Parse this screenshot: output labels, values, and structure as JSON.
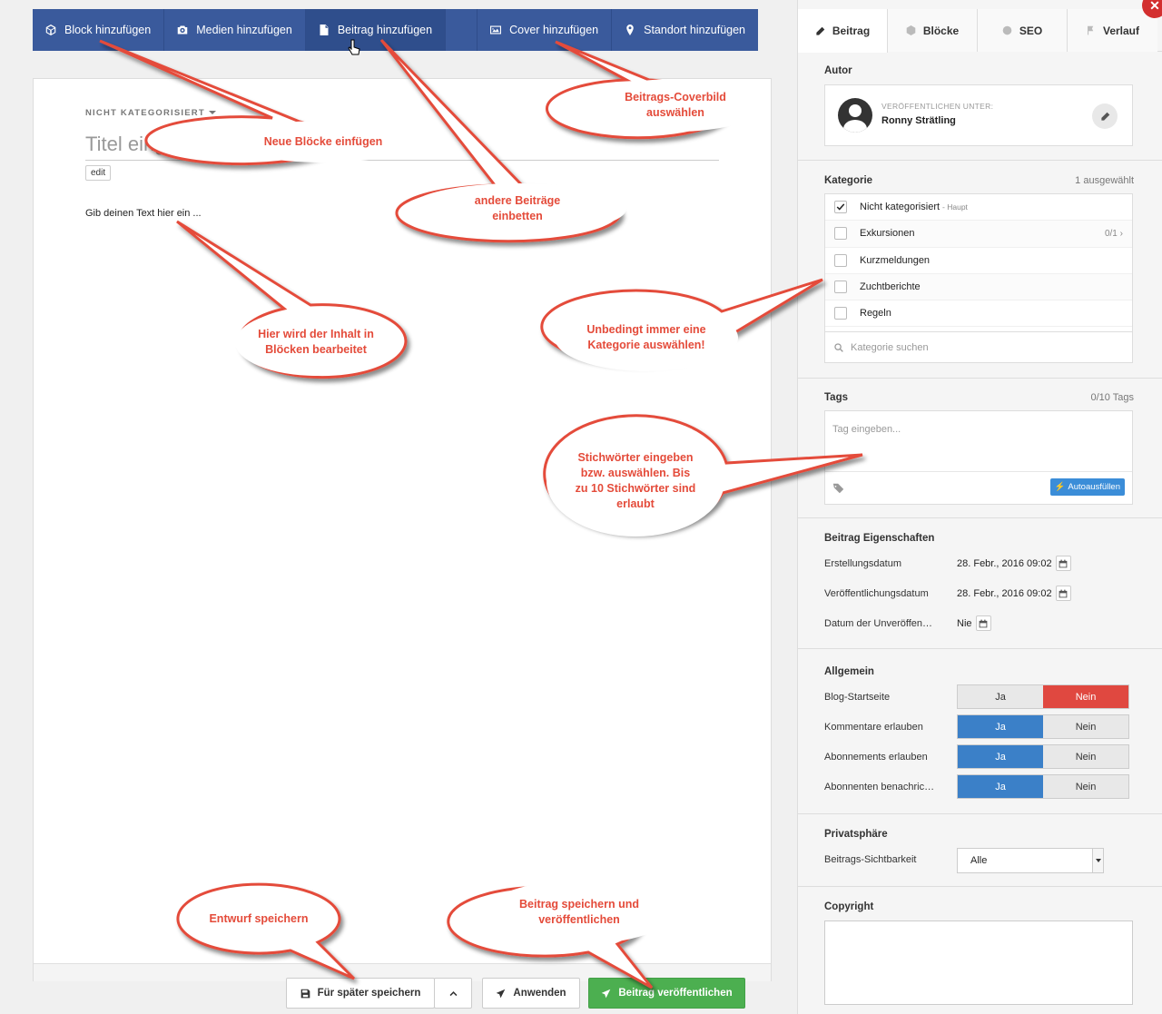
{
  "toolbar": {
    "items": [
      {
        "label": "Block hinzufügen",
        "icon": "cube-icon"
      },
      {
        "label": "Medien hinzufügen",
        "icon": "camera-icon"
      },
      {
        "label": "Beitrag hinzufügen",
        "icon": "document-icon"
      },
      {
        "label": "Cover hinzufügen",
        "icon": "image-icon"
      },
      {
        "label": "Standort hinzufügen",
        "icon": "map-pin-icon"
      }
    ]
  },
  "editor": {
    "category_label": "NICHT KATEGORISIERT",
    "title_placeholder": "Titel eingeben",
    "edit_label": "edit",
    "body_placeholder": "Gib deinen Text hier ein ..."
  },
  "actions": {
    "save_later": "Für später speichern",
    "apply": "Anwenden",
    "publish": "Beitrag veröffentlichen"
  },
  "sidebar": {
    "tabs": [
      {
        "label": "Beitrag",
        "icon": "pencil-icon"
      },
      {
        "label": "Blöcke",
        "icon": "cube-icon"
      },
      {
        "label": "SEO",
        "icon": "globe-icon"
      },
      {
        "label": "Verlauf",
        "icon": "flag-icon"
      }
    ],
    "author": {
      "title": "Autor",
      "publish_under_label": "VERÖFFENTLICHEN UNTER:",
      "name": "Ronny Strätling"
    },
    "category": {
      "title": "Kategorie",
      "selected_count": "1 ausgewählt",
      "items": [
        {
          "label": "Nicht kategorisiert",
          "sub": "- Haupt",
          "checked": true,
          "count": ""
        },
        {
          "label": "Exkursionen",
          "sub": "",
          "checked": false,
          "count": "0/1"
        },
        {
          "label": "Kurzmeldungen",
          "sub": "",
          "checked": false,
          "count": ""
        },
        {
          "label": "Zuchtberichte",
          "sub": "",
          "checked": false,
          "count": ""
        },
        {
          "label": "Regeln",
          "sub": "",
          "checked": false,
          "count": ""
        }
      ],
      "search_placeholder": "Kategorie suchen"
    },
    "tags": {
      "title": "Tags",
      "count": "0/10 Tags",
      "placeholder": "Tag eingeben...",
      "autofill": "Autoausfüllen"
    },
    "properties": {
      "title": "Beitrag Eigenschaften",
      "created_label": "Erstellungsdatum",
      "created_value": "28. Febr., 2016 09:02",
      "published_label": "Veröffentlichungsdatum",
      "published_value": "28. Febr., 2016 09:02",
      "unpublish_label": "Datum der Unveröffen…",
      "unpublish_value": "Nie"
    },
    "general": {
      "title": "Allgemein",
      "yes": "Ja",
      "no": "Nein",
      "rows": [
        {
          "label": "Blog-Startseite",
          "value": "Nein"
        },
        {
          "label": "Kommentare erlauben",
          "value": "Ja"
        },
        {
          "label": "Abonnements erlauben",
          "value": "Ja"
        },
        {
          "label": "Abonnenten benachric…",
          "value": "Ja"
        }
      ]
    },
    "privacy": {
      "title": "Privatsphäre",
      "visibility_label": "Beitrags-Sichtbarkeit",
      "visibility_value": "Alle"
    },
    "copyright": {
      "title": "Copyright"
    }
  },
  "callouts": {
    "new_blocks": "Neue Blöcke einfügen",
    "cover": "Beitrags-Coverbild auswählen",
    "embed": "andere Beiträge einbetten",
    "content": "Hier wird der Inhalt in Blöcken bearbeitet",
    "category": "Unbedingt immer eine Kategorie auswählen!",
    "tags": "Stichwörter eingeben bzw. auswählen. Bis zu 10 Stichwörter sind erlaubt",
    "draft": "Entwurf speichern",
    "publish": "Beitrag speichern und veröffentlichen"
  },
  "colors": {
    "toolbar": "#3a5a9c",
    "callout": "#e44b3a",
    "publish": "#4caf50",
    "toggle_on": "#3b80c8",
    "toggle_no": "#e04840"
  }
}
